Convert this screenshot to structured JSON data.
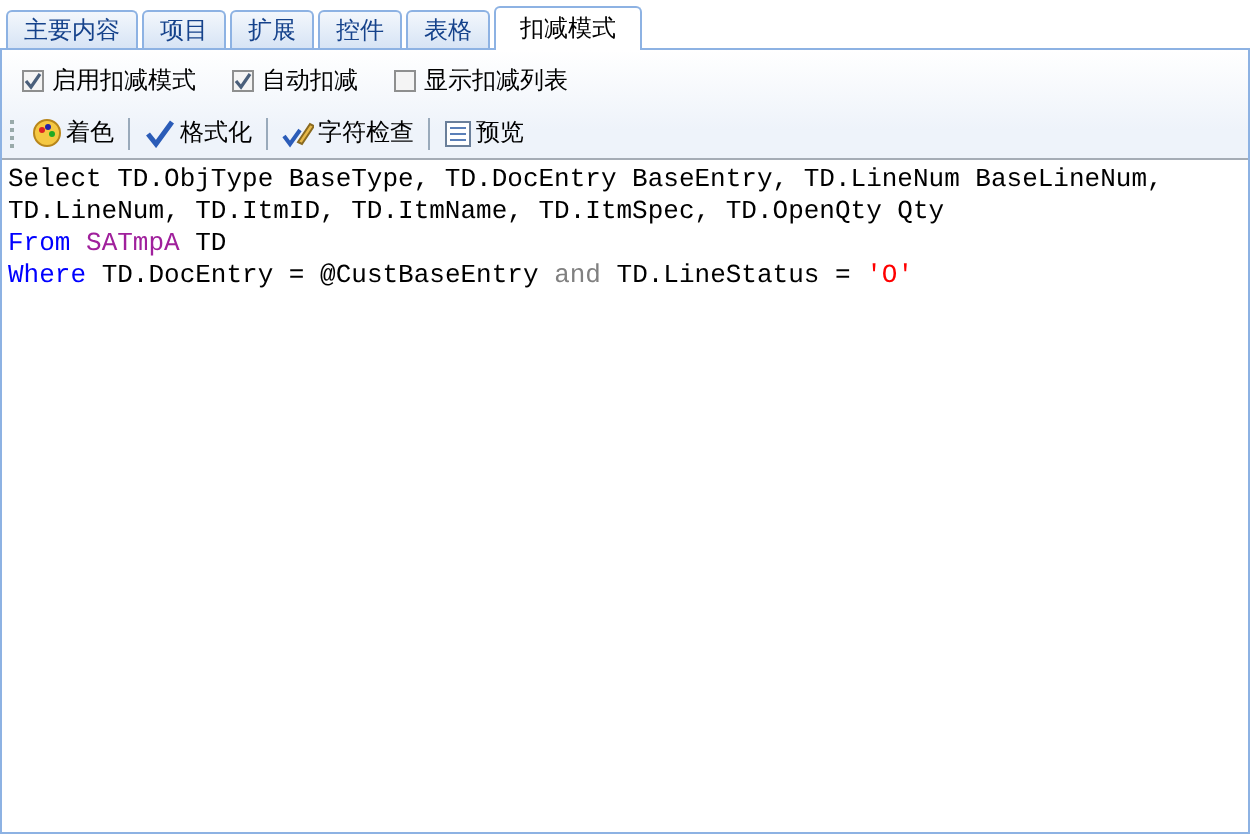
{
  "tabs": [
    {
      "label": "主要内容",
      "selected": false
    },
    {
      "label": "项目",
      "selected": false
    },
    {
      "label": "扩展",
      "selected": false
    },
    {
      "label": "控件",
      "selected": false
    },
    {
      "label": "表格",
      "selected": false
    },
    {
      "label": "扣减模式",
      "selected": true
    }
  ],
  "options": [
    {
      "label": "启用扣减模式",
      "checked": true
    },
    {
      "label": "自动扣减",
      "checked": true
    },
    {
      "label": "显示扣减列表",
      "checked": false
    }
  ],
  "toolbar": [
    {
      "kind": "palette",
      "label": "着色"
    },
    {
      "kind": "spell",
      "label": "格式化"
    },
    {
      "kind": "check",
      "label": "字符检查"
    },
    {
      "kind": "preview",
      "label": "预览"
    }
  ],
  "code_lines": [
    [
      {
        "kind": "plain",
        "text": "Select TD.ObjType BaseType, TD.DocEntry BaseEntry, TD.LineNum BaseLineNum,"
      }
    ],
    [
      {
        "kind": "plain",
        "text": "TD.LineNum, TD.ItmID, TD.ItmName, TD.ItmSpec, TD.OpenQty Qty"
      }
    ],
    [
      {
        "kind": "keyword",
        "text": "From "
      },
      {
        "kind": "table",
        "text": "SATmpA"
      },
      {
        "kind": "plain",
        "text": " TD"
      }
    ],
    [
      {
        "kind": "keyword",
        "text": "Where"
      },
      {
        "kind": "plain",
        "text": " TD.DocEntry = @CustBaseEntry "
      },
      {
        "kind": "operator",
        "text": "and"
      },
      {
        "kind": "plain",
        "text": " TD.LineStatus = "
      },
      {
        "kind": "string",
        "text": "'O'"
      }
    ]
  ]
}
